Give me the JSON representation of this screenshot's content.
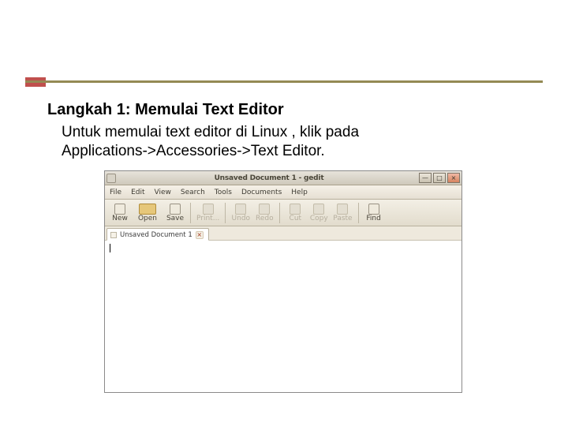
{
  "slide": {
    "heading": "Langkah 1: Memulai Text Editor",
    "body_line1": "Untuk memulai text editor di Linux , klik pada",
    "body_line2": "Applications->Accessories->Text Editor."
  },
  "app": {
    "title": "Unsaved Document 1 - gedit",
    "menu": {
      "file": "File",
      "edit": "Edit",
      "view": "View",
      "search": "Search",
      "tools": "Tools",
      "documents": "Documents",
      "help": "Help"
    },
    "toolbar": {
      "new": "New",
      "open": "Open",
      "save": "Save",
      "print": "Print...",
      "undo": "Undo",
      "redo": "Redo",
      "cut": "Cut",
      "copy": "Copy",
      "paste": "Paste",
      "find": "Find"
    },
    "tab_label": "Unsaved Document 1",
    "winbtn": {
      "min": "—",
      "max": "□",
      "close": "×"
    }
  }
}
